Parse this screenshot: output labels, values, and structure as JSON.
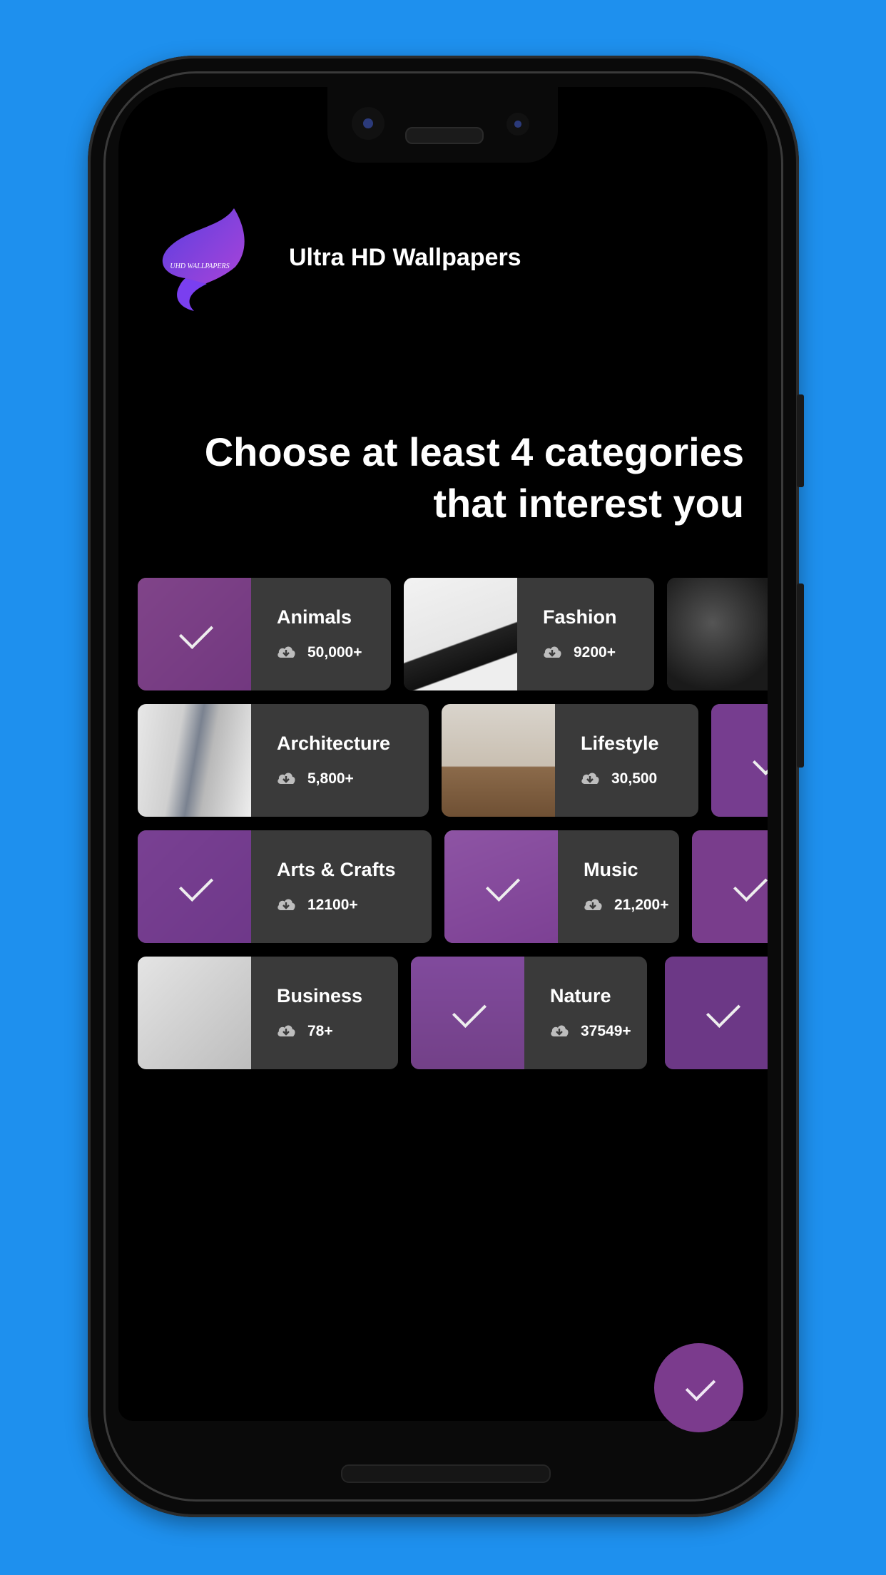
{
  "app": {
    "title": "Ultra HD Wallpapers",
    "logo_text": "UHD WALLPAPERS"
  },
  "headline": {
    "line1": "Choose at least 4 categories",
    "line2": "that interest you"
  },
  "colors": {
    "background": "#1e90ee",
    "screen": "#000000",
    "card": "#3a3a3a",
    "accent": "#7b3b8d"
  },
  "categories": {
    "animals": {
      "name": "Animals",
      "count": "50,000+",
      "selected": true
    },
    "fashion": {
      "name": "Fashion",
      "count": "9200+",
      "selected": false
    },
    "architecture": {
      "name": "Architecture",
      "count": "5,800+",
      "selected": false
    },
    "lifestyle": {
      "name": "Lifestyle",
      "count": "30,500",
      "selected": false
    },
    "arts": {
      "name": "Arts & Crafts",
      "count": "12100+",
      "selected": true
    },
    "music": {
      "name": "Music",
      "count": "21,200+",
      "selected": true
    },
    "business": {
      "name": "Business",
      "count": "78+",
      "selected": false
    },
    "nature": {
      "name": "Nature",
      "count": "37549+",
      "selected": true
    }
  },
  "icons": {
    "download": "cloud-download-icon",
    "check": "check-icon",
    "fab": "check-icon"
  }
}
